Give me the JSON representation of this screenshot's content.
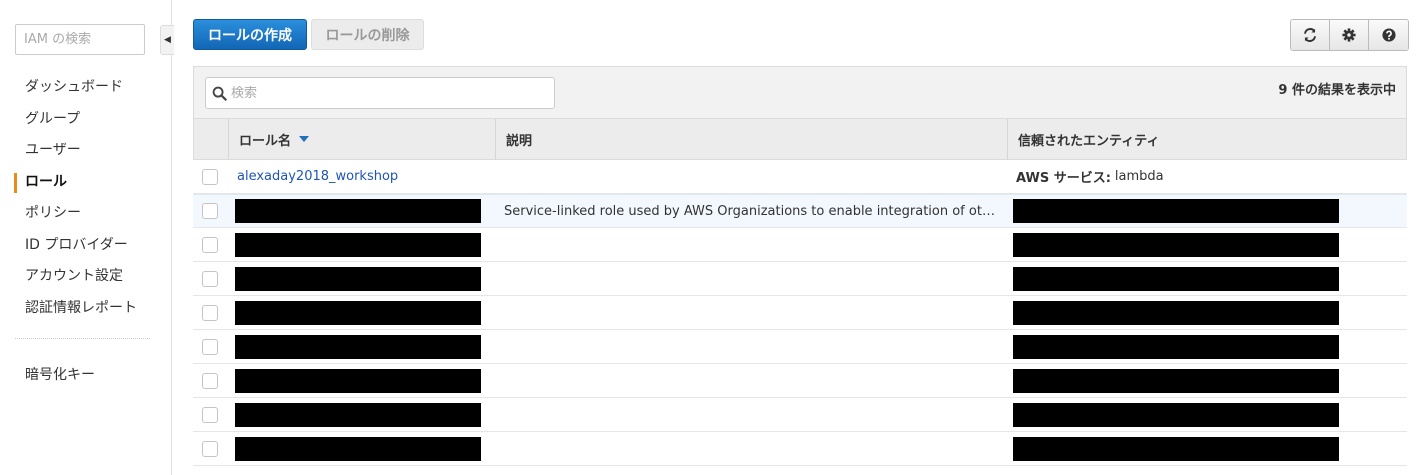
{
  "sidebar": {
    "search_placeholder": "IAM の検索",
    "collapse_glyph": "◀",
    "items": [
      {
        "label": "ダッシュボード"
      },
      {
        "label": "グループ"
      },
      {
        "label": "ユーザー"
      },
      {
        "label": "ロール",
        "active": true
      },
      {
        "label": "ポリシー"
      },
      {
        "label": "ID プロバイダー"
      },
      {
        "label": "アカウント設定"
      },
      {
        "label": "認証情報レポート"
      }
    ],
    "secondary_items": [
      {
        "label": "暗号化キー"
      }
    ]
  },
  "toolbar": {
    "create_label": "ロールの作成",
    "delete_label": "ロールの削除",
    "icons": [
      "refresh-icon",
      "gear-icon",
      "help-icon"
    ]
  },
  "table": {
    "search_placeholder": "検索",
    "result_count": "9 件の結果を表示中",
    "columns": {
      "name": "ロール名",
      "description": "説明",
      "trusted_entity": "信頼されたエンティティ"
    },
    "rows": [
      {
        "name": "alexaday2018_workshop",
        "description": "",
        "entity_label": "AWS サービス:",
        "entity_value": "lambda"
      },
      {
        "name": "",
        "description": "Service-linked role used by AWS Organizations to enable integration of other…",
        "entity_label": "",
        "entity_value": ""
      },
      {
        "name": "",
        "description": "",
        "entity_label": "",
        "entity_value": ""
      },
      {
        "name": "",
        "description": "",
        "entity_label": "",
        "entity_value": ""
      },
      {
        "name": "",
        "description": "",
        "entity_label": "",
        "entity_value": ""
      },
      {
        "name": "",
        "description": "",
        "entity_label": "",
        "entity_value": ""
      },
      {
        "name": "",
        "description": "",
        "entity_label": "",
        "entity_value": ""
      },
      {
        "name": "",
        "description": "",
        "entity_label": "",
        "entity_value": ""
      },
      {
        "name": "",
        "description": "",
        "entity_label": "",
        "entity_value": ""
      }
    ]
  },
  "colors": {
    "primary": "#1a73c4",
    "link": "#1f55b5",
    "active_marker": "#e88b1a"
  }
}
